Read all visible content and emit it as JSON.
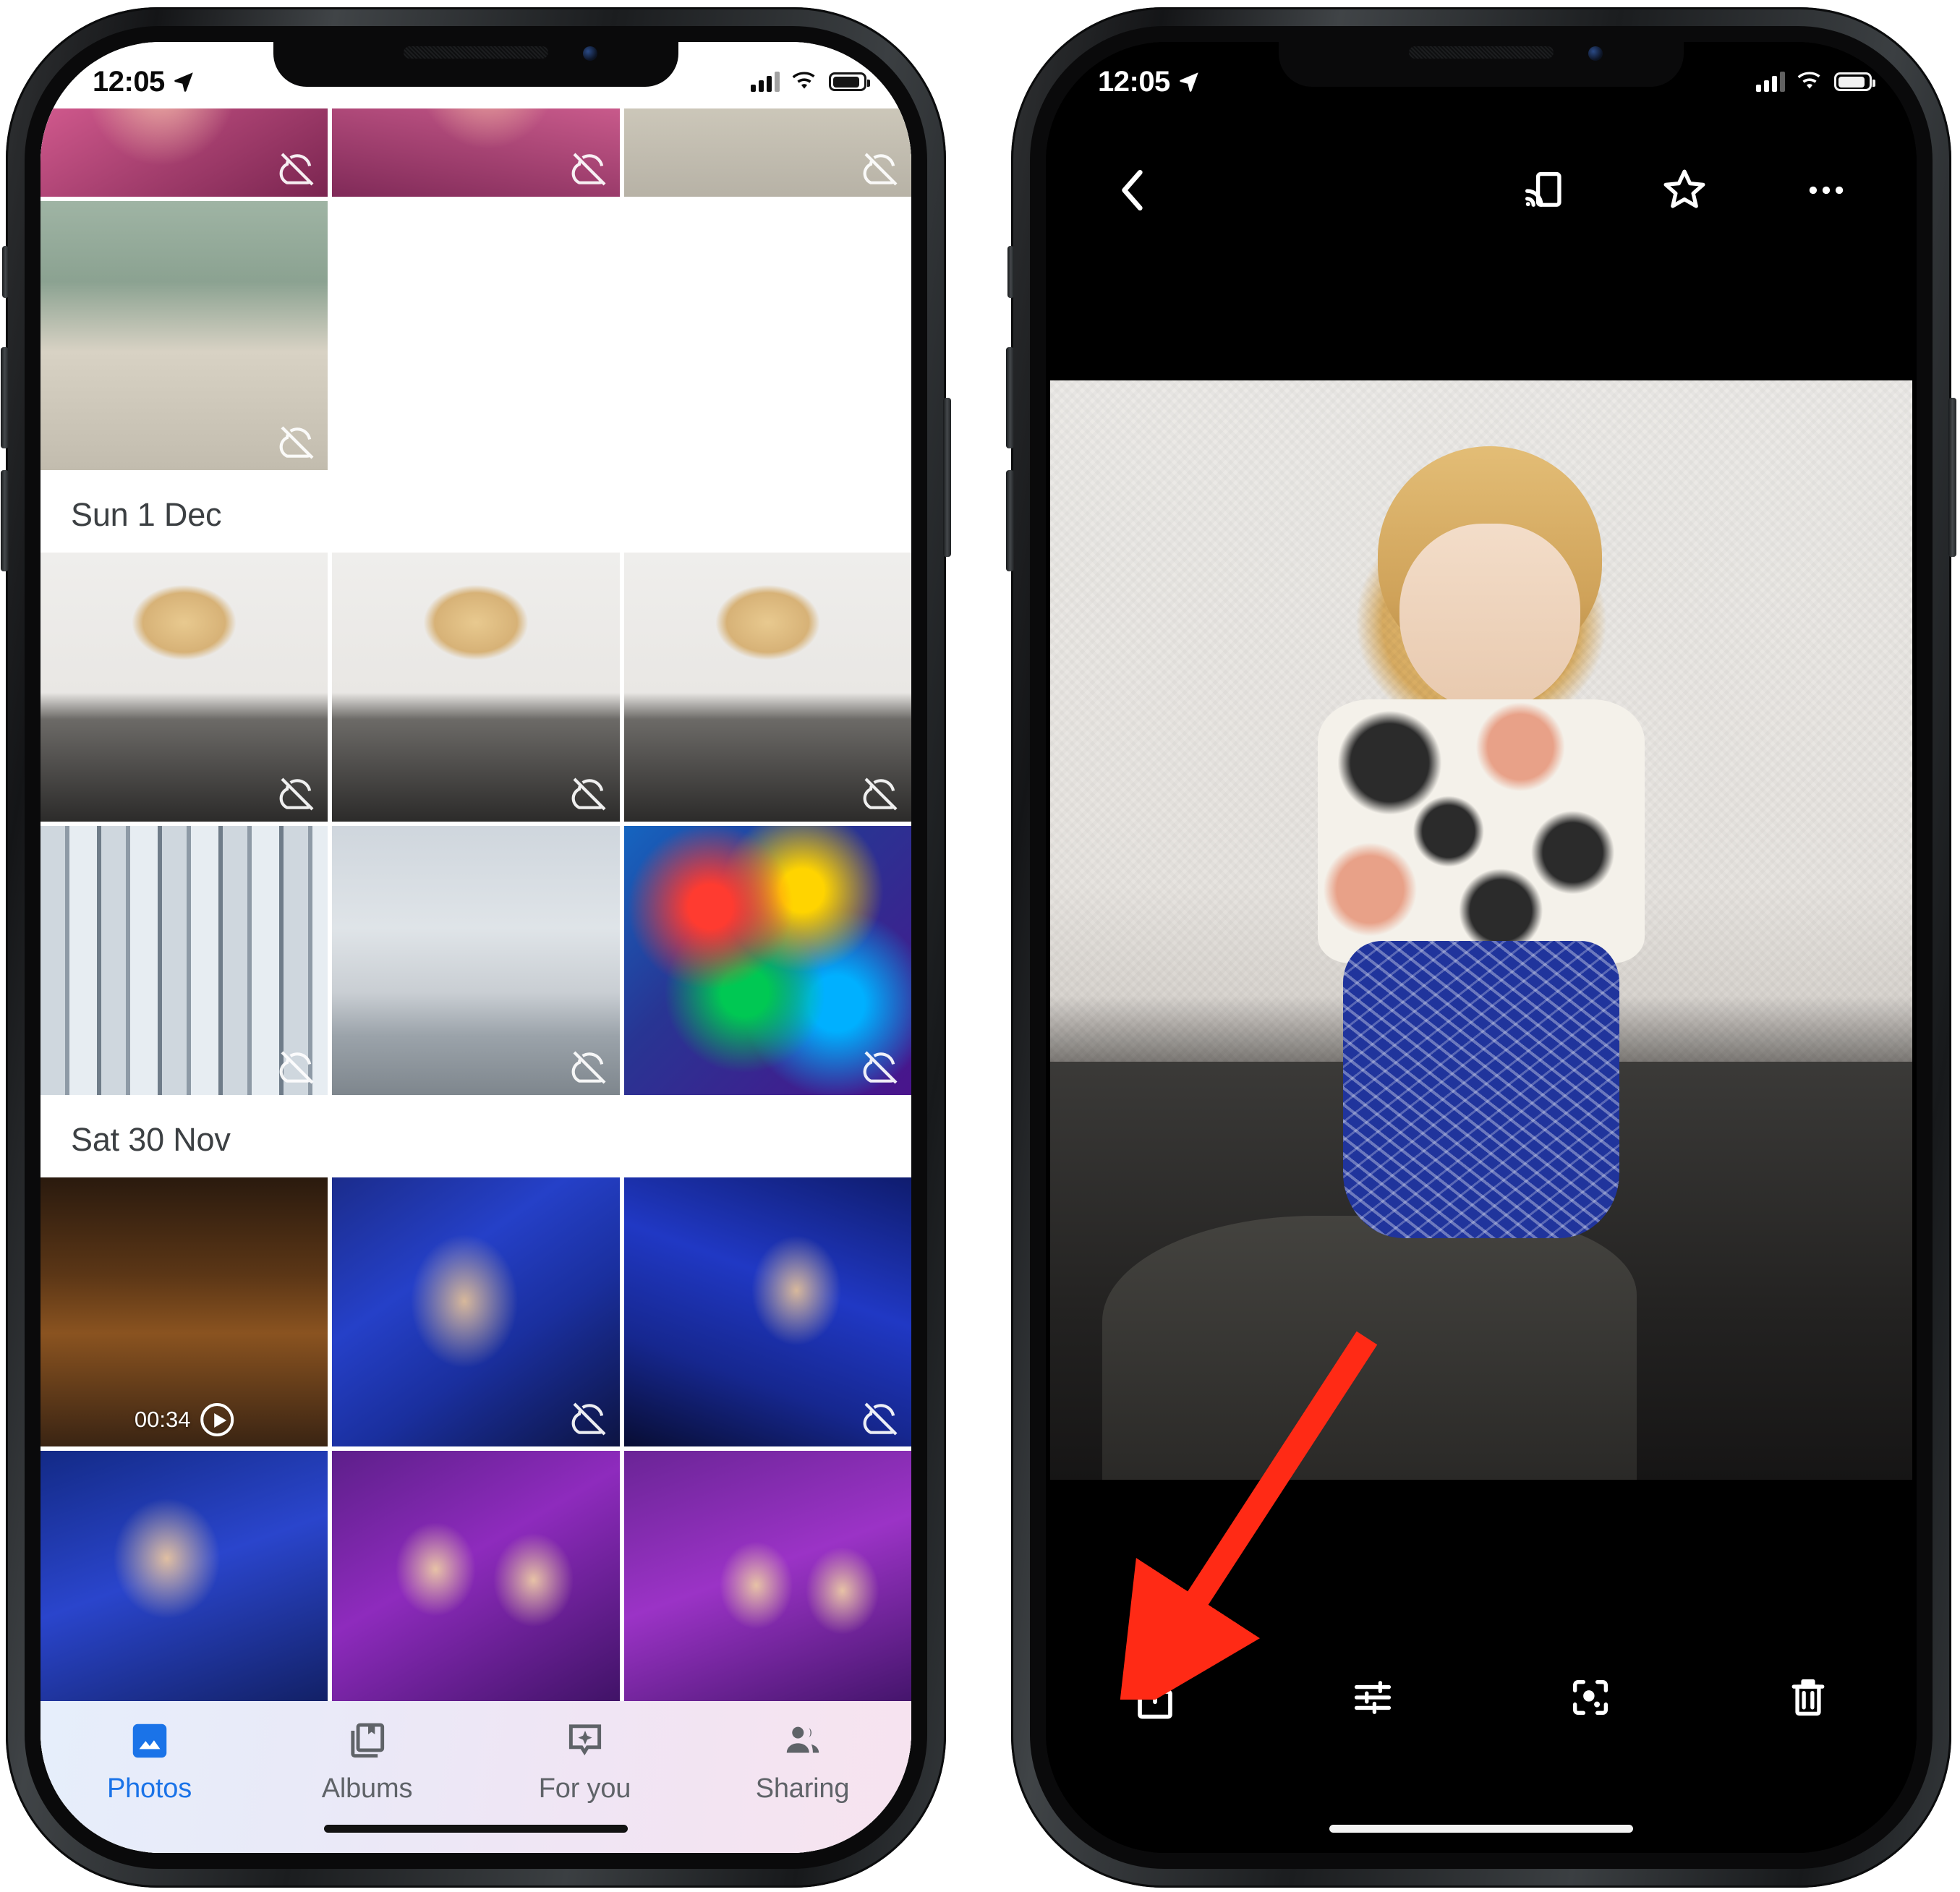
{
  "left_phone": {
    "status_bar": {
      "time": "12:05",
      "location_icon": "location-arrow-icon",
      "signal_icon": "cellular-signal-icon",
      "wifi_icon": "wifi-icon",
      "battery_icon": "battery-icon"
    },
    "app": "Google Photos",
    "sections": [
      {
        "date_header": "",
        "rows": [
          {
            "cells": [
              {
                "art": "pink-hands",
                "badge_cloud_off": true,
                "video": null
              },
              {
                "art": "pink-hands2",
                "badge_cloud_off": true,
                "video": null
              },
              {
                "art": "tv-room",
                "badge_cloud_off": true,
                "video": null
              }
            ]
          },
          {
            "cells": [
              {
                "art": "tv-cowboy",
                "badge_cloud_off": true,
                "video": null
              },
              {
                "art": "blank",
                "badge_cloud_off": false,
                "video": null
              },
              {
                "art": "blank",
                "badge_cloud_off": false,
                "video": null
              }
            ]
          }
        ]
      },
      {
        "date_header": "Sun 1 Dec",
        "rows": [
          {
            "cells": [
              {
                "art": "baby-plane",
                "badge_cloud_off": true,
                "video": null
              },
              {
                "art": "baby-plane",
                "badge_cloud_off": true,
                "video": null
              },
              {
                "art": "baby-plane",
                "badge_cloud_off": true,
                "video": null
              }
            ]
          },
          {
            "cells": [
              {
                "art": "mirror",
                "badge_cloud_off": true,
                "video": null
              },
              {
                "art": "sky",
                "badge_cloud_off": true,
                "video": null
              },
              {
                "art": "rainbow-hand",
                "badge_cloud_off": true,
                "video": null
              }
            ]
          }
        ]
      },
      {
        "date_header": "Sat 30 Nov",
        "rows": [
          {
            "cells": [
              {
                "art": "night-street",
                "badge_cloud_off": false,
                "video": "00:34"
              },
              {
                "art": "blue-ride",
                "badge_cloud_off": true,
                "video": null
              },
              {
                "art": "blue-ride2",
                "badge_cloud_off": true,
                "video": null
              }
            ]
          },
          {
            "cells": [
              {
                "art": "selfie-blue",
                "badge_cloud_off": false,
                "video": null
              },
              {
                "art": "selfie-purple",
                "badge_cloud_off": false,
                "video": null
              },
              {
                "art": "selfie-purple2",
                "badge_cloud_off": false,
                "video": null
              }
            ]
          }
        ]
      }
    ],
    "tab_bar": {
      "active_color": "#1a73e8",
      "inactive_color": "#5f6368",
      "tabs": [
        {
          "label": "Photos",
          "icon": "photos-mountain-icon",
          "active": true
        },
        {
          "label": "Albums",
          "icon": "albums-book-icon",
          "active": false
        },
        {
          "label": "For you",
          "icon": "for-you-sparkle-icon",
          "active": false
        },
        {
          "label": "Sharing",
          "icon": "sharing-people-icon",
          "active": false
        }
      ]
    }
  },
  "right_phone": {
    "status_bar": {
      "time": "12:05",
      "location_icon": "location-arrow-icon",
      "signal_icon": "cellular-signal-icon",
      "wifi_icon": "wifi-icon",
      "battery_icon": "battery-icon"
    },
    "top_toolbar": {
      "back_icon": "back-chevron-icon",
      "actions": [
        {
          "icon": "cast-icon",
          "name": "cast-button"
        },
        {
          "icon": "star-icon",
          "name": "favorite-button"
        },
        {
          "icon": "more-dots-icon",
          "name": "overflow-menu-button"
        }
      ]
    },
    "bottom_toolbar": {
      "actions": [
        {
          "icon": "share-icon",
          "name": "share-button",
          "highlighted": true
        },
        {
          "icon": "edit-sliders-icon",
          "name": "edit-button",
          "highlighted": false
        },
        {
          "icon": "lens-icon",
          "name": "lens-button",
          "highlighted": false
        },
        {
          "icon": "trash-icon",
          "name": "delete-button",
          "highlighted": false
        }
      ]
    },
    "annotation": {
      "type": "arrow",
      "color": "#ff2a15",
      "points_to": "share-button"
    }
  }
}
